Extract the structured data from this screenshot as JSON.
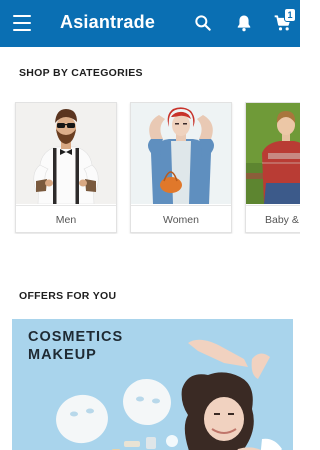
{
  "header": {
    "title": "Asiantrade",
    "icons": {
      "menu": "menu-icon",
      "search": "search-icon",
      "notifications": "bell-icon",
      "cart": "cart-icon"
    },
    "cart_count": "1",
    "bar_color": "#0a6fb3"
  },
  "categories": {
    "title": "SHOP BY CATEGORIES",
    "items": [
      {
        "label": "Men"
      },
      {
        "label": "Women"
      },
      {
        "label": "Baby &"
      }
    ]
  },
  "offers": {
    "title": "OFFERS FOR YOU",
    "banner": {
      "line1": "COSMETICS",
      "line2": "MAKEUP",
      "background": "#a9d4ec"
    }
  }
}
